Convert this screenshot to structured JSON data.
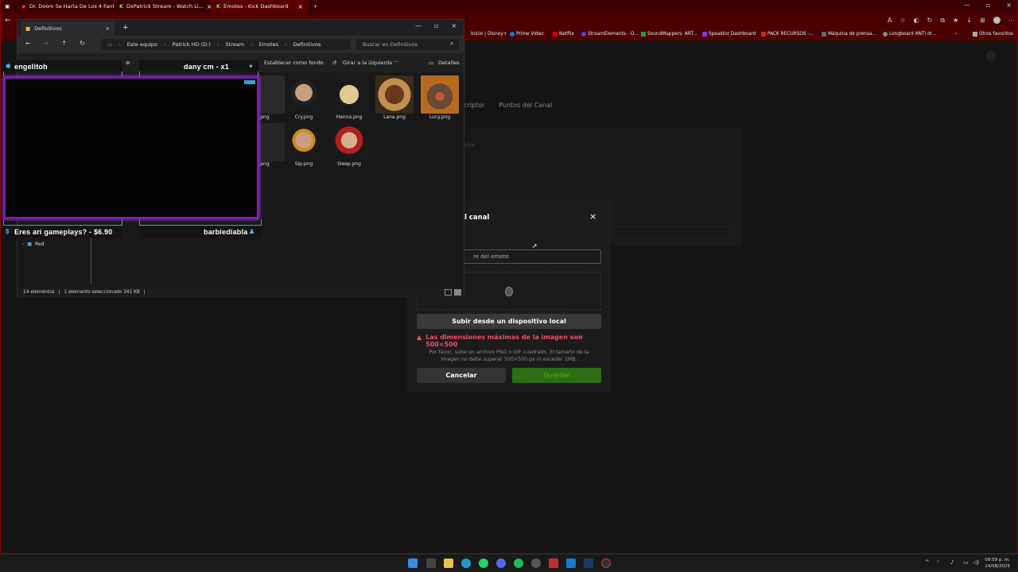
{
  "browser": {
    "tabs": [
      {
        "label": "Dr. Doom Se Harta De Los 4 Fant...",
        "icon": "youtube-icon"
      },
      {
        "label": "DxPatrick Stream - Watch Li...",
        "icon": "kick-icon"
      },
      {
        "label": "Emotes - Kick Dashboard",
        "icon": "kick-icon"
      }
    ],
    "new_tab": "+",
    "bookmarks": [
      {
        "label": "Inicio | Disney+",
        "color": "#1a3a8a"
      },
      {
        "label": "Prime Video",
        "color": "#1a7ad0"
      },
      {
        "label": "Netflix",
        "color": "#d00"
      },
      {
        "label": "StreamElements - O...",
        "color": "#5a3fd0"
      },
      {
        "label": "SoundMappers: ART...",
        "color": "#2a9d3a"
      },
      {
        "label": "Speaktor Dashboard",
        "color": "#8a3ad0"
      },
      {
        "label": "PACK RECURSOS -...",
        "color": "#cc2222"
      },
      {
        "label": "Máquina de prensa...",
        "color": "#666"
      },
      {
        "label": "Longboard ANTI dr...",
        "color": "#888"
      },
      {
        "label": "Otros favoritos",
        "color": "#aaa"
      }
    ]
  },
  "kick": {
    "tabs": [
      "criptor",
      "Puntos del Canal"
    ],
    "faint_label": "ntre"
  },
  "modal": {
    "title": "l canal",
    "close": "×",
    "name_placeholder": "re del emote",
    "upload_label": "Subir desde un dispositivo local",
    "error": "Las dimensiones máximas de la imagen son 500×500",
    "hint": "Por favor, sube un archivo PNG o GIF cuadrado. El tamaño de la imagen no debe superar 500×500 px ni exceder 1MB.",
    "cancel": "Cancelar",
    "save": "Guardar"
  },
  "explorer": {
    "tab_label": "Definitivos",
    "new_tab": "+",
    "breadcrumbs": [
      "Este equipo",
      "Patrick HD (D:)",
      "Stream",
      "Emotes",
      "Definitivos"
    ],
    "search_placeholder": "Buscar en Definitivos",
    "commands": {
      "set_bg": "Establecer como fondo",
      "rotate_left": "Girar a la izquierda",
      "more": "···",
      "details": "Detalles"
    },
    "files": [
      {
        "name": ".png"
      },
      {
        "name": "Cry.png"
      },
      {
        "name": "Hanna.png"
      },
      {
        "name": "Lana.png"
      },
      {
        "name": "Lucy.png"
      },
      {
        "name": ".png"
      },
      {
        "name": "Sip.png"
      },
      {
        "name": "Sleep.png"
      }
    ],
    "sidebar_item": "Red",
    "status": {
      "count": "14 elementos",
      "selected": "1 elemento seleccionado  341 KB"
    }
  },
  "overlay": {
    "top_left_name": "engelitoh",
    "top_right_name": "dany cm - x1",
    "bottom_left_name": "Eres ari gameplays? - $6.90",
    "bottom_right_name": "barbiediabla"
  },
  "taskbar": {
    "time": "09:59 p. m.",
    "date": "14/08/2025"
  }
}
